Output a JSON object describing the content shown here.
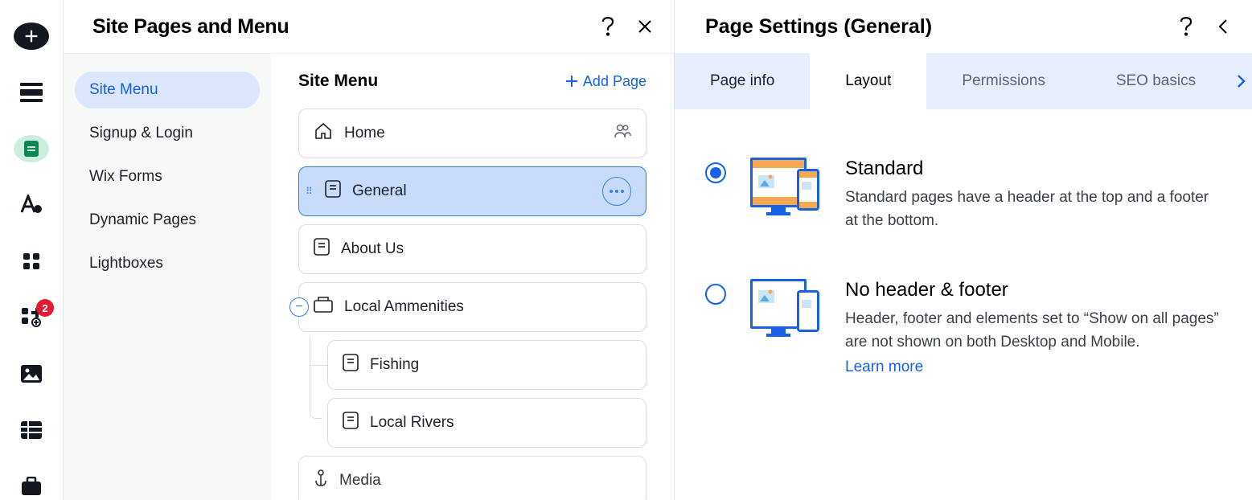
{
  "toolbar": {
    "badge": "2"
  },
  "panel1": {
    "title": "Site Pages and Menu",
    "categories": [
      "Site Menu",
      "Signup & Login",
      "Wix Forms",
      "Dynamic Pages",
      "Lightboxes"
    ],
    "tree_title": "Site Menu",
    "add_label": "Add Page",
    "pages": {
      "home": "Home",
      "general": "General",
      "about": "About Us",
      "local": "Local Ammenities",
      "fishing": "Fishing",
      "rivers": "Local Rivers",
      "media": "Media"
    }
  },
  "panel2": {
    "title": "Page Settings (General)",
    "tabs": [
      "Page info",
      "Layout",
      "Permissions",
      "SEO basics"
    ],
    "opt1_title": "Standard",
    "opt1_desc": "Standard pages have a header at the top and a footer at the bottom.",
    "opt2_title": "No header & footer",
    "opt2_desc": "Header, footer and elements set to “Show on all pages” are not shown on both Desktop and Mobile.",
    "learn_more": "Learn more"
  }
}
